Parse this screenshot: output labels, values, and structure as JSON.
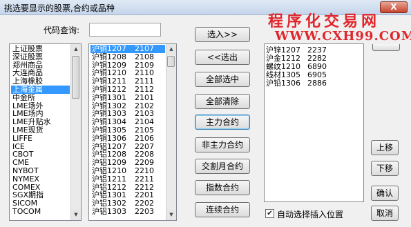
{
  "window": {
    "title": "挑选要显示的股票,合约或品种",
    "close_glyph": "X"
  },
  "watermark": {
    "line1": "程序化交易网",
    "line2": "WWW.CXH99.COM"
  },
  "search": {
    "label": "代码查询:",
    "value": ""
  },
  "markets": {
    "items": [
      "上证股票",
      "深证股票",
      "郑州商品",
      "大连商品",
      "上海橡胶",
      "上海金属",
      "中金所",
      "LME场外",
      "LME场内",
      "LME升贴水",
      "LME现货",
      "LIFFE",
      "ICE",
      "CBOT",
      "CME",
      "NYBOT",
      "NYMEX",
      "COMEX",
      "SGX期指",
      "SICOM",
      "TOCOM"
    ],
    "selected_index": 5
  },
  "contracts": {
    "items": [
      {
        "name": "沪铜1207",
        "code": "2107"
      },
      {
        "name": "沪铜1208",
        "code": "2108"
      },
      {
        "name": "沪铜1209",
        "code": "2109"
      },
      {
        "name": "沪铜1210",
        "code": "2110"
      },
      {
        "name": "沪铜1211",
        "code": "2111"
      },
      {
        "name": "沪铜1212",
        "code": "2112"
      },
      {
        "name": "沪铜1301",
        "code": "2101"
      },
      {
        "name": "沪铜1302",
        "code": "2102"
      },
      {
        "name": "沪铜1303",
        "code": "2103"
      },
      {
        "name": "沪铜1304",
        "code": "2104"
      },
      {
        "name": "沪铜1305",
        "code": "2105"
      },
      {
        "name": "沪铜1306",
        "code": "2106"
      },
      {
        "name": "沪铝1207",
        "code": "2207"
      },
      {
        "name": "沪铝1208",
        "code": "2208"
      },
      {
        "name": "沪铝1209",
        "code": "2209"
      },
      {
        "name": "沪铝1210",
        "code": "2210"
      },
      {
        "name": "沪铝1211",
        "code": "2211"
      },
      {
        "name": "沪铝1212",
        "code": "2212"
      },
      {
        "name": "沪铝1301",
        "code": "2201"
      },
      {
        "name": "沪铝1302",
        "code": "2202"
      },
      {
        "name": "沪铝1303",
        "code": "2203"
      }
    ],
    "selected_index": 0
  },
  "buttons": {
    "add": "选入>>",
    "remove": "<<选出",
    "select_all": "全部选中",
    "clear_all": "全部清除",
    "main_contract": "主力合约",
    "non_main_contract": "非主力合约",
    "delivery_month": "交割月合约",
    "index_contract": "指数合约",
    "continuous_contract": "连续合约",
    "move_up": "上移",
    "move_down": "下移",
    "ok": "确认",
    "cancel": "取消"
  },
  "selected": {
    "items": [
      {
        "name": "沪锌1207",
        "code": "2237"
      },
      {
        "name": "沪金1212",
        "code": "2282"
      },
      {
        "name": "螺纹1210",
        "code": "6890"
      },
      {
        "name": "线材1305",
        "code": "6905"
      },
      {
        "name": "沪铅1306",
        "code": "2886"
      }
    ]
  },
  "auto_select": {
    "label": "自动选择插入位置",
    "checked": true,
    "check_glyph": "✔"
  },
  "scroll": {
    "up_glyph": "▲",
    "down_glyph": "▼"
  }
}
